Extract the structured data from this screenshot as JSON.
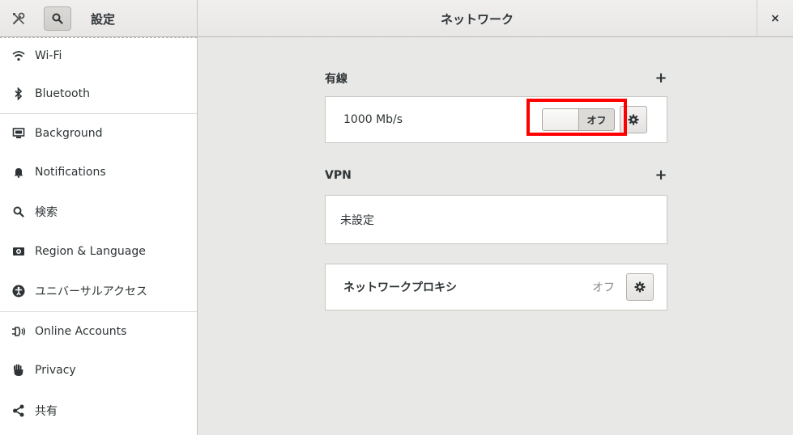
{
  "header": {
    "app_title": "設定",
    "page_title": "ネットワーク",
    "close_glyph": "×"
  },
  "sidebar": {
    "items": [
      {
        "label": "Wi-Fi",
        "icon": "wifi-icon"
      },
      {
        "label": "Bluetooth",
        "icon": "bluetooth-icon"
      },
      {
        "label": "Background",
        "icon": "background-icon"
      },
      {
        "label": "Notifications",
        "icon": "bell-icon"
      },
      {
        "label": "検索",
        "icon": "search-icon"
      },
      {
        "label": "Region & Language",
        "icon": "region-icon"
      },
      {
        "label": "ユニバーサルアクセス",
        "icon": "accessibility-icon"
      },
      {
        "label": "Online Accounts",
        "icon": "online-accounts-icon"
      },
      {
        "label": "Privacy",
        "icon": "hand-icon"
      },
      {
        "label": "共有",
        "icon": "share-icon"
      }
    ]
  },
  "wired": {
    "heading": "有線",
    "add_glyph": "+",
    "speed": "1000 Mb/s",
    "toggle_state": "オフ"
  },
  "vpn": {
    "heading": "VPN",
    "add_glyph": "+",
    "empty_label": "未設定"
  },
  "proxy": {
    "label": "ネットワークプロキシ",
    "state": "オフ"
  },
  "colors": {
    "highlight": "#ff0000",
    "sidebar_bg": "#ffffff",
    "content_bg": "#e8e8e7"
  }
}
